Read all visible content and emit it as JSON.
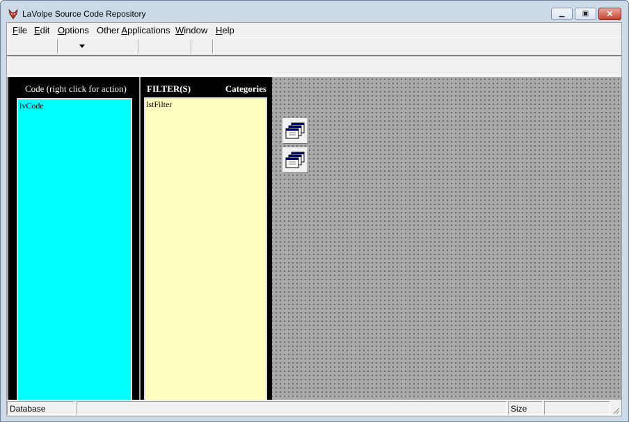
{
  "window": {
    "title": "LaVolpe Source Code Repository"
  },
  "menu": [
    {
      "label": "File",
      "accel": "F",
      "rest": "ile"
    },
    {
      "label": "Edit",
      "accel": "E",
      "rest": "dit"
    },
    {
      "label": "Options",
      "accel": "O",
      "rest": "ptions"
    },
    {
      "label": "Other Applications",
      "accel": "A",
      "pre": "Other ",
      "rest": "pplications"
    },
    {
      "label": "Window",
      "accel": "W",
      "rest": "indow"
    },
    {
      "label": "Help",
      "accel": "H",
      "rest": "elp"
    }
  ],
  "code_panel": {
    "header": "Code (right click for action)",
    "list_name": "lvCode",
    "bg": "#00ffff"
  },
  "filter_panel": {
    "header_left": "FILTER(S)",
    "header_right": "Categories",
    "list_name": "lstFilter",
    "bg": "#ffffc0"
  },
  "status": {
    "database": "Database",
    "size": "Size"
  },
  "icons": {
    "app": "fox-icon",
    "minimize": "minimize-icon",
    "maximize": "maximize-icon",
    "close": "close-icon",
    "window_cascade_1": "window-stack-icon",
    "window_cascade_2": "window-stack-icon"
  }
}
